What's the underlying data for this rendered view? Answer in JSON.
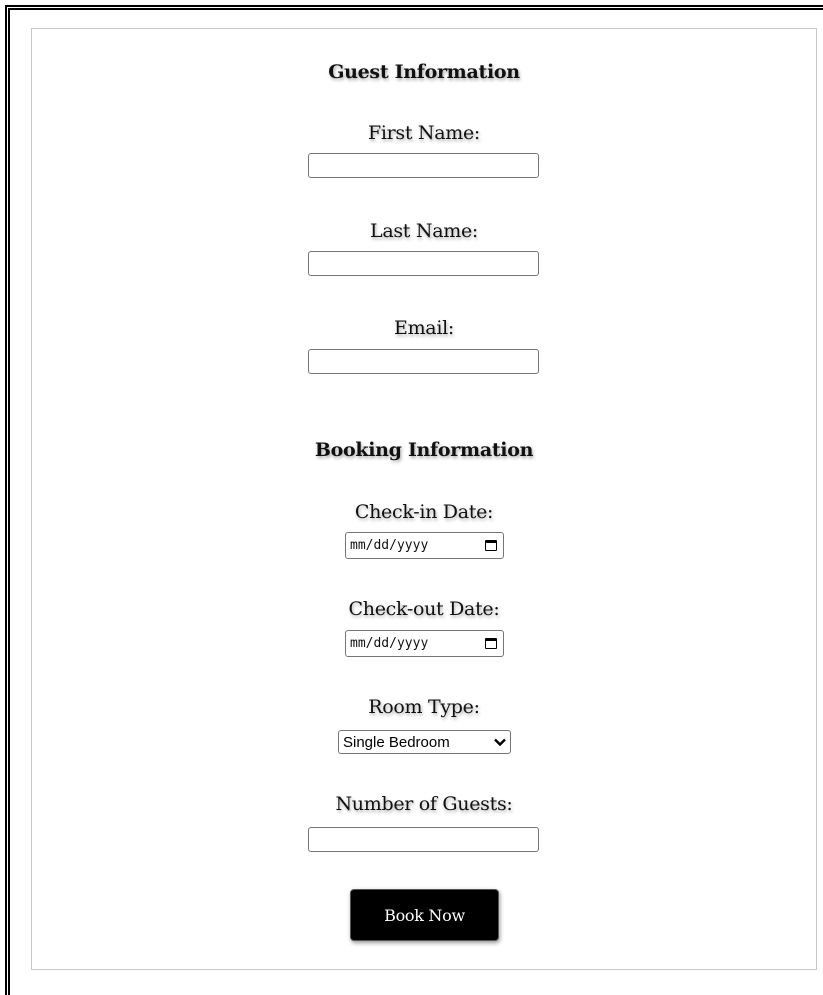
{
  "guest_section": {
    "title": "Guest Information",
    "first_name_label": "First Name:",
    "first_name_value": "",
    "last_name_label": "Last Name:",
    "last_name_value": "",
    "email_label": "Email:",
    "email_value": ""
  },
  "booking_section": {
    "title": "Booking Information",
    "checkin_label": "Check-in Date:",
    "checkin_placeholder": "mm/dd/yyyy",
    "checkout_label": "Check-out Date:",
    "checkout_placeholder": "mm/dd/yyyy",
    "room_type_label": "Room Type:",
    "room_type_selected": "Single Bedroom",
    "guests_label": "Number of Guests:",
    "guests_value": ""
  },
  "actions": {
    "submit_label": "Book Now"
  },
  "icons": {
    "calendar": "calendar-icon",
    "chevron": "chevron-down-icon"
  }
}
